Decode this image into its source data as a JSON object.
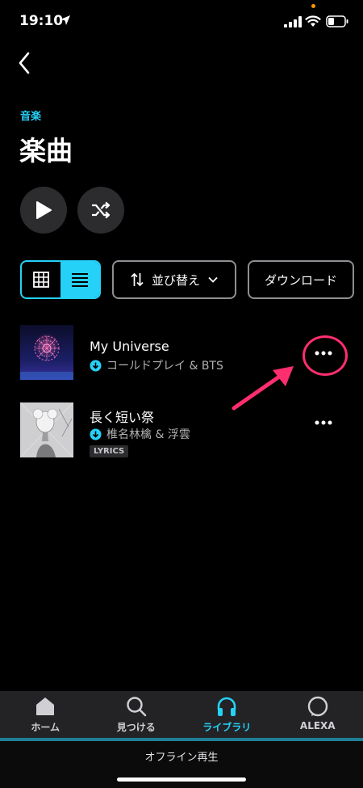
{
  "status_bar": {
    "time": "19:10"
  },
  "header": {
    "category": "音楽",
    "title": "楽曲"
  },
  "controls": {
    "sort_label": "並び替え",
    "download_label": "ダウンロード"
  },
  "tracks": [
    {
      "title": "My Universe",
      "artist": "コールドプレイ & BTS",
      "downloaded": true
    },
    {
      "title": "長く短い祭",
      "artist": "椎名林檎 & 浮雲",
      "downloaded": true,
      "badge": "LYRICS"
    }
  ],
  "tabs": [
    {
      "label": "ホーム",
      "icon": "home-icon"
    },
    {
      "label": "見つける",
      "icon": "search-icon"
    },
    {
      "label": "ライブラリ",
      "icon": "headphones-icon",
      "active": true
    },
    {
      "label": "ALEXA",
      "icon": "alexa-icon"
    }
  ],
  "offline": {
    "label": "オフライン再生"
  },
  "colors": {
    "accent": "#25d1f7",
    "highlight": "#ff2e6e",
    "tab_bg": "#232326"
  }
}
